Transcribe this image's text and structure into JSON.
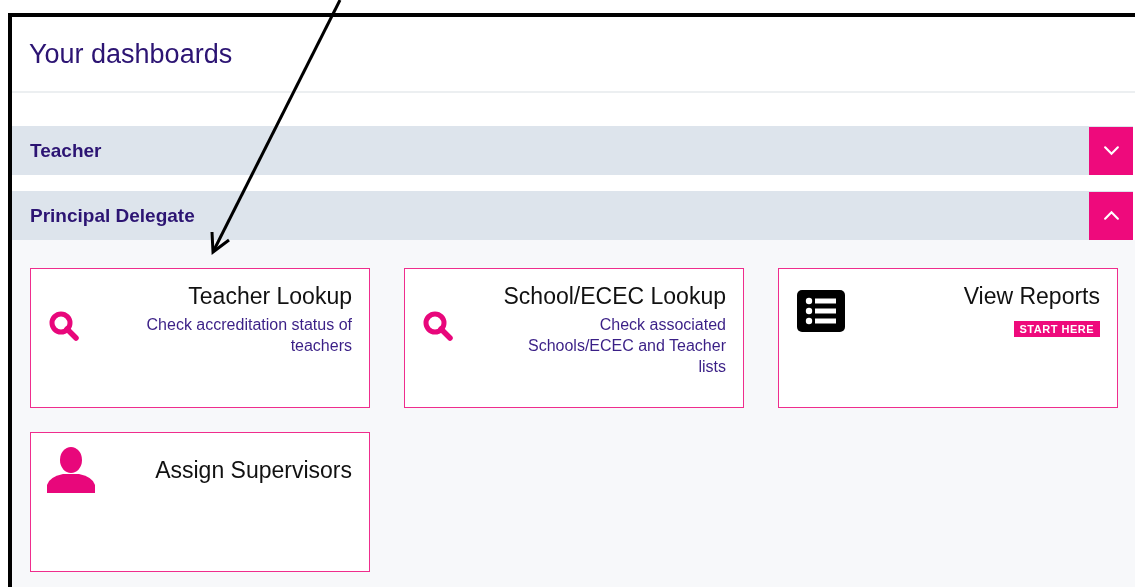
{
  "title": "Your dashboards",
  "sections": [
    {
      "label": "Teacher",
      "expanded": false
    },
    {
      "label": "Principal Delegate",
      "expanded": true,
      "cards": [
        {
          "kind": "search",
          "title": "Teacher Lookup",
          "description": "Check accreditation status of teachers"
        },
        {
          "kind": "search",
          "title": "School/ECEC Lookup",
          "description": "Check associated Schools/ECEC and Teacher lists"
        },
        {
          "kind": "list",
          "title": "View Reports",
          "badge": "START HERE"
        },
        {
          "kind": "person",
          "title": "Assign Supervisors"
        }
      ]
    }
  ]
}
